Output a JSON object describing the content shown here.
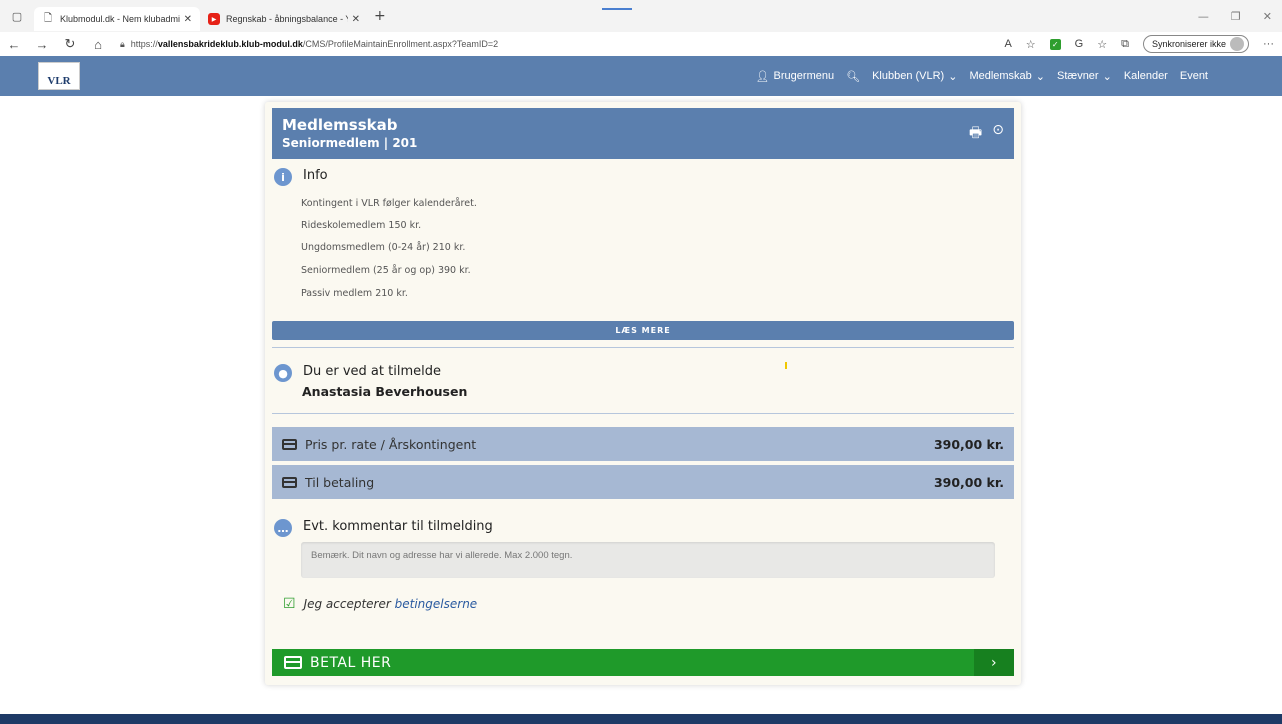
{
  "browser": {
    "tabs": [
      {
        "label": "Klubmodul.dk - Nem klubadmin",
        "active": true
      },
      {
        "label": "Regnskab - åbningsbalance - Yo",
        "active": false
      }
    ],
    "url_prefix": "https://",
    "url_host": "vallensbakrideklub.klub-modul.dk",
    "url_path": "/CMS/ProfileMaintainEnrollment.aspx?TeamID=2",
    "sync_label": "Synkroniserer ikke"
  },
  "nav": {
    "logo_text": "VLR",
    "items": [
      "Brugermenu",
      "Klubben (VLR)",
      "Medlemskab",
      "Stævner",
      "Kalender",
      "Event"
    ]
  },
  "card": {
    "title": "Medlemsskab",
    "subtitle": "Seniormedlem | 201",
    "info_title": "Info",
    "info_lines": [
      "Kontingent i VLR følger kalenderåret.",
      "Rideskolemedlem 150 kr.",
      "Ungdomsmedlem (0-24 år) 210 kr.",
      "Seniormedlem (25 år og op) 390 kr.",
      "Passiv medlem 210 kr."
    ],
    "read_more": "LÆS MERE",
    "enroll_title": "Du er ved at tilmelde",
    "enroll_name": "Anastasia Beverhousen",
    "price_label": "Pris pr. rate / Årskontingent",
    "price_amount": "390,00 kr.",
    "total_label": "Til betaling",
    "total_amount": "390,00 kr.",
    "comment_title": "Evt. kommentar til tilmelding",
    "comment_placeholder": "Bemærk. Dit navn og adresse har vi allerede. Max 2.000 tegn.",
    "accept_text": "Jeg accepterer",
    "accept_link": "betingelserne",
    "pay_button": "BETAL HER"
  }
}
